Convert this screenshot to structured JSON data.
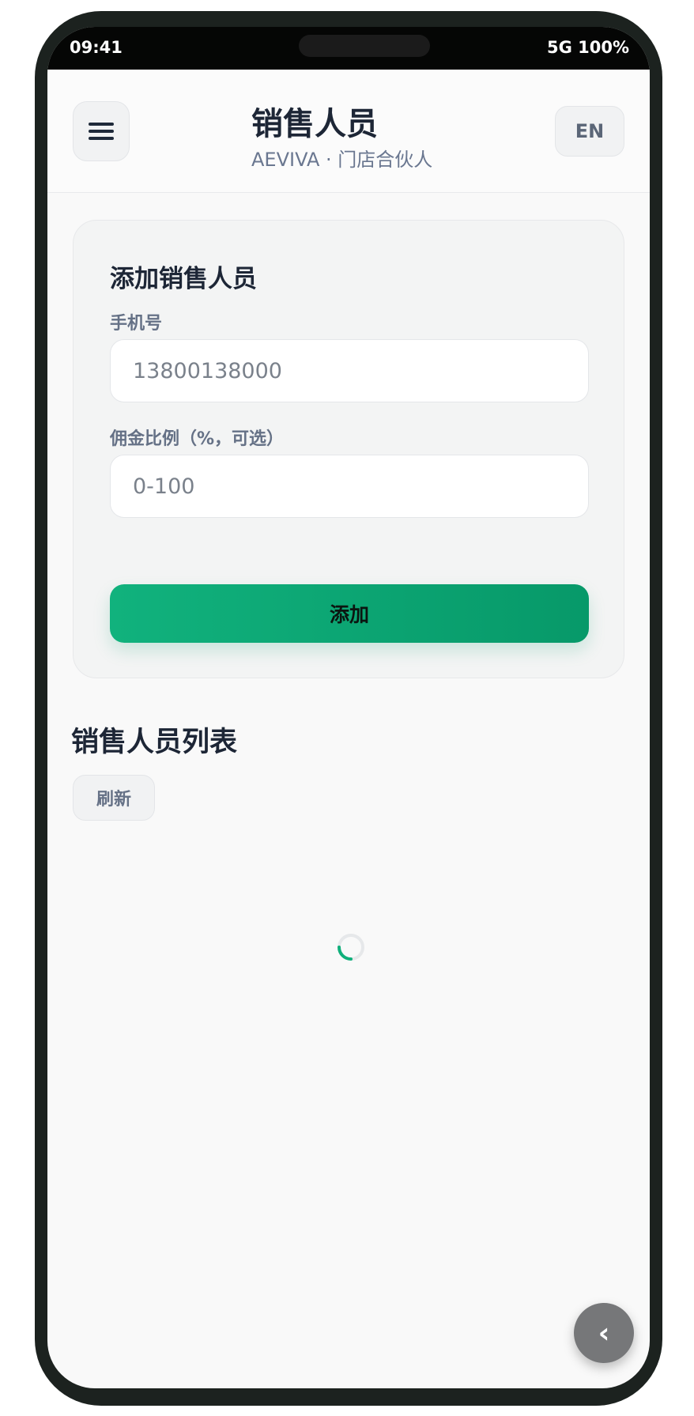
{
  "status_bar": {
    "time": "09:41",
    "network": "5G 100%"
  },
  "header": {
    "menu_icon": "hamburger-menu-icon",
    "title": "销售人员",
    "subtitle": "AEVIVA · 门店合伙人",
    "language_button": "EN"
  },
  "add_form": {
    "title": "添加销售人员",
    "phone_label": "手机号",
    "phone_placeholder": "13800138000",
    "commission_label": "佣金比例（%，可选）",
    "commission_placeholder": "0-100",
    "submit_label": "添加"
  },
  "list": {
    "title": "销售人员列表",
    "refresh_label": "刷新",
    "loading_icon": "loading-spinner-icon"
  },
  "back_button": {
    "icon": "chevron-left-icon",
    "label": "‹"
  },
  "colors": {
    "accent": "#10b07b",
    "title": "#1d2636",
    "muted": "#657186"
  }
}
